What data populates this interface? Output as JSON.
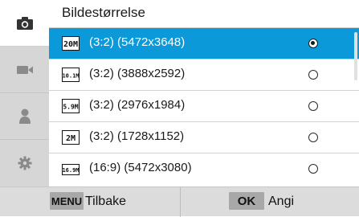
{
  "header": {
    "title": "Bildestørrelse"
  },
  "sidebar": {
    "tabs": [
      {
        "icon": "camera-icon",
        "active": true
      },
      {
        "icon": "video-icon",
        "active": false
      },
      {
        "icon": "person-icon",
        "active": false
      },
      {
        "icon": "gear-icon",
        "active": false
      }
    ]
  },
  "sizes": [
    {
      "icon_text": "20M",
      "label": "(3:2) (5472x3648)",
      "selected": true
    },
    {
      "icon_text": "10.1M",
      "label": "(3:2) (3888x2592)",
      "selected": false
    },
    {
      "icon_text": "5.9M",
      "label": "(3:2) (2976x1984)",
      "selected": false
    },
    {
      "icon_text": "2M",
      "label": "(3:2) (1728x1152)",
      "selected": false
    },
    {
      "icon_text": "16.9M",
      "label": "(16:9) (5472x3080)",
      "selected": false
    }
  ],
  "footer": {
    "menu_key": "MENU",
    "back_label": "Tilbake",
    "ok_key": "OK",
    "set_label": "Angi"
  },
  "colors": {
    "selected_bg": "#0c99d9",
    "sidebar_bg": "#d6d6d6",
    "footer_bg": "#dcdcdc"
  }
}
